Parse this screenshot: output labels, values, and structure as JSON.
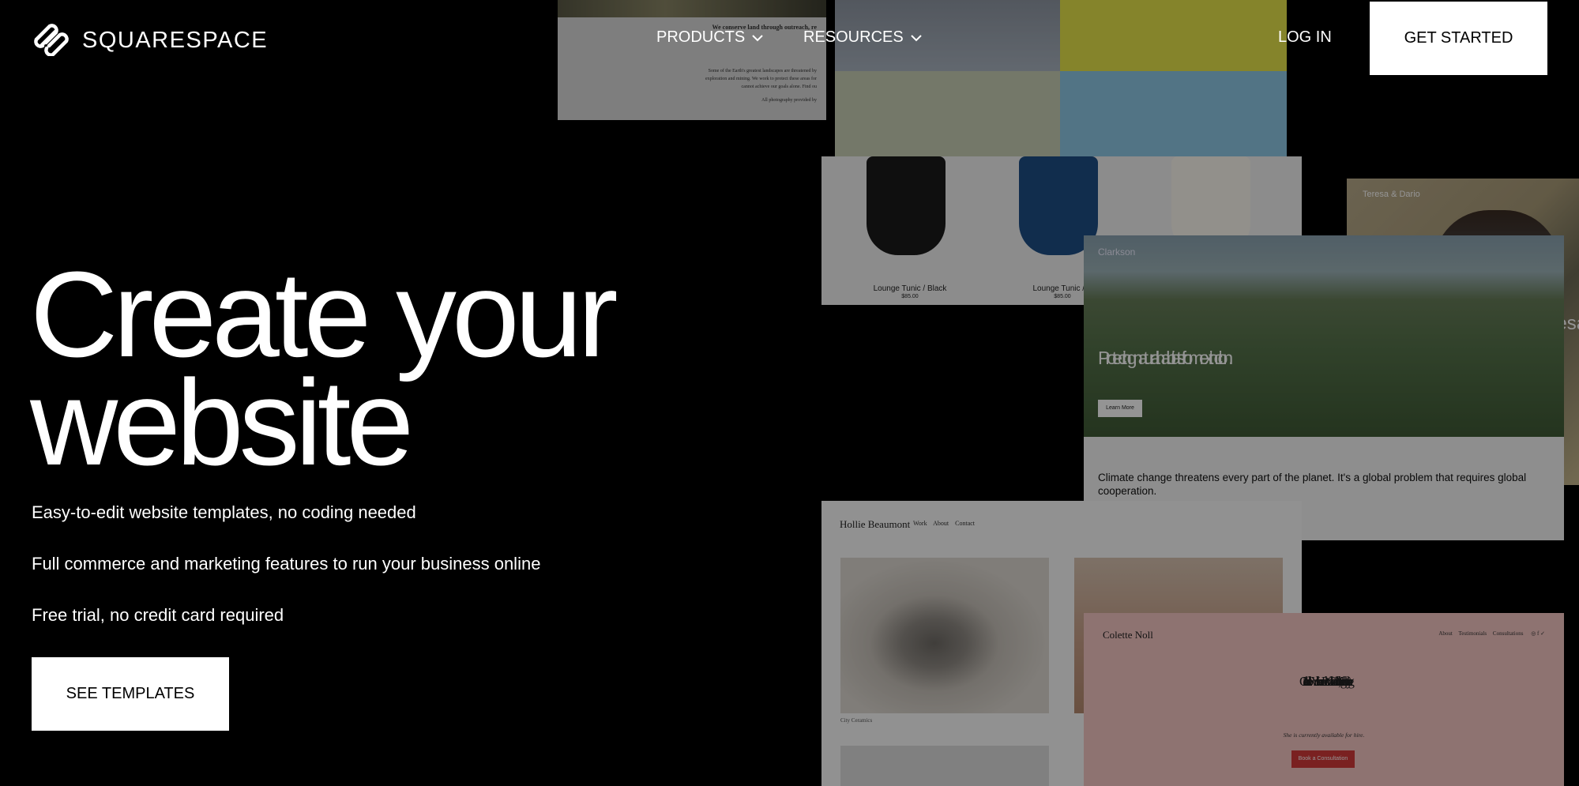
{
  "brand": {
    "name": "SQUARESPACE",
    "icon": "squarespace-logo-icon"
  },
  "nav": {
    "products": "PRODUCTS",
    "resources": "RESOURCES",
    "login": "LOG IN",
    "get_started": "GET STARTED"
  },
  "hero": {
    "headline_line1": "Create your",
    "headline_line2": "website",
    "bullets": [
      "Easy-to-edit website templates, no coding needed",
      "Full commerce and marketing features to run your business online",
      "Free trial, no credit card required"
    ],
    "cta": "SEE TEMPLATES"
  },
  "previews": {
    "essay": {
      "line1": "We conserve land through outreach, re",
      "line2": "Some of the Earth's greatest landscapes are threatened by",
      "line3": "exploration and mining. We work to protect these areas for",
      "line4": "cannot achieve our goals alone. Find ou",
      "line5": "All photography provided by"
    },
    "store": {
      "item1": "Lounge Tunic / Black",
      "item1_price": "$85.00",
      "item2": "Lounge Tunic / B",
      "item2_price": "$85.00"
    },
    "clarkson": {
      "brand": "Clarkson",
      "headline": "Protecting natural habitats from extinction.",
      "button": "Learn More",
      "copy": "Climate change threatens every part of the planet. It's a global problem that requires global cooperation."
    },
    "wedding": {
      "names": "Teresa & Dario",
      "big": "Teresa"
    },
    "hollie": {
      "name": "Hollie Beaumont",
      "nav": [
        "Work",
        "About",
        "Contact"
      ],
      "caption": "City Ceramics"
    },
    "colette": {
      "name": "Colette Noll",
      "nav": [
        "About",
        "Testimonials",
        "Consultations"
      ],
      "headline": "Colette Noll is a New York-based Personal Chef and Nutritionist, focusing on healthy eating.",
      "sub": "She is currently available for hire.",
      "button": "Book a Consultation"
    }
  },
  "colors": {
    "background": "#000000",
    "text": "#ffffff",
    "button_bg": "#ffffff",
    "button_text": "#000000"
  }
}
